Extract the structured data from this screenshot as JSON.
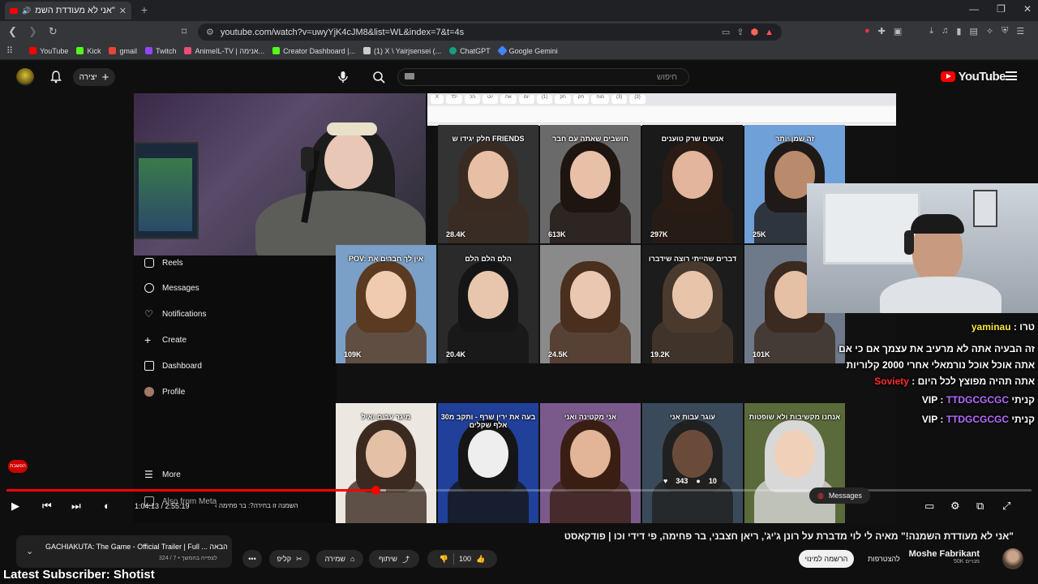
{
  "browser": {
    "tab_title": "\"אני לא מעודדת השמנה\" מאי",
    "url": "youtube.com/watch?v=uwyYjK4cJM8&list=WL&index=7&t=4s",
    "bookmarks": [
      "YouTube",
      "Kick",
      "gmail",
      "Twitch",
      "AnimeIL-TV | אנימה...",
      "Creator Dashboard |...",
      "(1) X \\ Yairjsensei (...",
      "ChatGPT",
      "Google Gemini"
    ],
    "colors": {
      "bookmark_icons": [
        "#ff0000",
        "#53fc18",
        "#ea4335",
        "#9146ff",
        "#e94e77",
        "#ff3333",
        "#cccccc",
        "#10a37f",
        "#4285f4"
      ]
    }
  },
  "youtube": {
    "logo_text": "YouTube",
    "search_placeholder": "חיפוש",
    "create_label": "יצירה",
    "accent": "#ff0000"
  },
  "video": {
    "inner_tabs": [
      "X",
      "ילד",
      "הכ",
      "יוט",
      "אח",
      "יומ",
      "(1)",
      "חק",
      "חק",
      "מוח",
      "(3)",
      "(3)"
    ],
    "tiles": [
      {
        "overlay": "חלק יגידו ש FRIENDS",
        "views": "28.4K",
        "colors": [
          "#333",
          "#3a2b22",
          "#e7bfa5"
        ]
      },
      {
        "overlay": "חושבים שאתה עם חבר",
        "views": "613K",
        "colors": [
          "#6a6a6a",
          "#1e1410",
          "#e8c0a8"
        ]
      },
      {
        "overlay": "אנשים שרק טוענים",
        "views": "297K",
        "colors": [
          "#1a1a1a",
          "#2a1c15",
          "#e3b59c"
        ]
      },
      {
        "overlay": "זה שמן יותר",
        "views": "25K",
        "colors": [
          "#6fa0d8",
          "#1f1a18",
          "#b98a6c"
        ]
      },
      {
        "overlay": "POV: אין לך חברים את",
        "views": "109K",
        "colors": [
          "#7aa0c8",
          "#5a3a20",
          "#f0cbb0"
        ]
      },
      {
        "overlay": "הלם הלם הלם",
        "views": "20.4K",
        "colors": [
          "#2a2a2a",
          "#151515",
          "#e8c6ad"
        ]
      },
      {
        "overlay": "",
        "views": "24.5K",
        "colors": [
          "#8a8a8a",
          "#4a2e1e",
          "#e9c7b0"
        ]
      },
      {
        "overlay": "דברים שהייתי רוצה שידברו",
        "views": "19.2K",
        "colors": [
          "#1c1c1c",
          "#4a3a2e",
          "#e8c4ab"
        ]
      },
      {
        "overlay": "",
        "views": "101K",
        "colors": [
          "#6e7a8a",
          "#3a2a20",
          "#e6c0a4"
        ]
      },
      {
        "overlay": "מיגר עבים ואיל",
        "views": "",
        "colors": [
          "#ece7e0",
          "#3b2a20",
          "#e4c0a6"
        ]
      },
      {
        "overlay": "בעה את ירין שרף - ותקב מ30 אלף שקלים",
        "views": "",
        "colors": [
          "#20409a",
          "#151515",
          "#eeeeee"
        ]
      },
      {
        "overlay": "אני מקטינה ואני",
        "views": "",
        "colors": [
          "#7a5a8a",
          "#3a1e14",
          "#e2b598"
        ]
      },
      {
        "overlay": "עוגר עבות אני",
        "views": "",
        "colors": [
          "#3a4a5a",
          "#202020",
          "#6a4b3a"
        ]
      },
      {
        "overlay": "אנחנו מקשיבות ולא שופטות",
        "views": "",
        "colors": [
          "#5a6a3a",
          "#d8d8d8",
          "#f0d0b8"
        ]
      }
    ],
    "tile_likes": "343",
    "tile_comments": "10",
    "ig_menu": [
      "Reels",
      "Messages",
      "Notifications",
      "Create",
      "Dashboard",
      "Profile",
      "More",
      "Also from Meta"
    ],
    "ig_messages_bubble": "Messages",
    "chat": [
      {
        "user": "yaminau",
        "msg": "טרו",
        "color": "#f5e642"
      },
      {
        "user": "Soviety",
        "msg": "זה הבעיה אתה לא מרעיב את עצמך אם כי אם אתה אוכל אוכל נורמאלי אחרי 2000 קלוריות אתה תהיה מפוצץ לכל היום",
        "color": "#ff2b2b"
      },
      {
        "user": "TTDGCGCGC",
        "msg": "קניתי VIP",
        "color": "#b56bff"
      },
      {
        "user": "TTDGCGCGC",
        "msg": "קניתי VIP",
        "color": "#b56bff"
      }
    ],
    "progress_fraction": 0.36,
    "buffer_fraction": 0.37
  },
  "player": {
    "time": "1:04:13 / 2:55:19",
    "chapter": "השמנה זו בחירה?: בר פחימה"
  },
  "below": {
    "title": "\"אני לא מעודדת השמנה!\" מאיה לי לוי מדברת על רונן ג'יג', ריאן חצבני, בר פחימה, פי דידי וכו | פודקאסט",
    "channel_name": "Moshe Fabrikant",
    "subs": "50K מנויים",
    "join_label": "להצטרפות",
    "subscribe_label": "הרשמה למינוי",
    "likes": "100",
    "share_label": "שיתוף",
    "save_label": "שמירה",
    "clip_label": "קליפ",
    "playlist_title": "GACHIAKUTA: The Game - Official Trailer | Full ...  הבאה",
    "playlist_sub": "לצפייה בהמשך • 7 / 324",
    "overlay_latest": "Latest Subscriber: Shotist",
    "live_badge": "הפשבת"
  }
}
